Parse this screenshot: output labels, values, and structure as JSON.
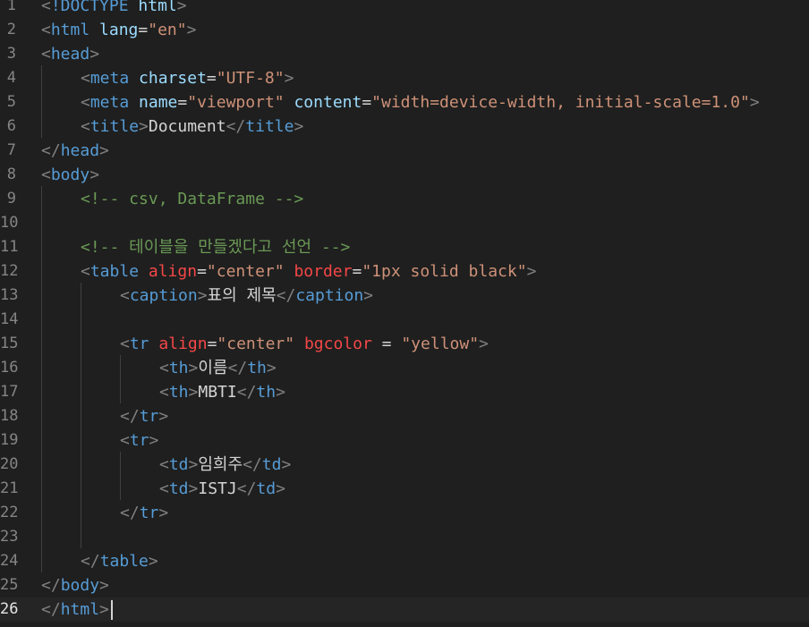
{
  "editor": {
    "language": "html",
    "colors": {
      "background": "#1f1f1f",
      "line_number": "#858585",
      "tag": "#569cd6",
      "attribute": "#9cdcfe",
      "deprecated_attribute": "#f44747",
      "string": "#ce9178",
      "comment": "#6a9955",
      "punctuation": "#808080",
      "text": "#d4d4d4"
    },
    "current_line": 26,
    "lines": [
      {
        "n": "1",
        "indent": 0,
        "tokens": [
          [
            "punct",
            "<"
          ],
          [
            "tag",
            "!DOCTYPE"
          ],
          [
            "text",
            " "
          ],
          [
            "attr",
            "html"
          ],
          [
            "punct",
            ">"
          ]
        ]
      },
      {
        "n": "2",
        "indent": 0,
        "tokens": [
          [
            "punct",
            "<"
          ],
          [
            "tag",
            "html"
          ],
          [
            "text",
            " "
          ],
          [
            "attr",
            "lang"
          ],
          [
            "eq",
            "="
          ],
          [
            "str",
            "\"en\""
          ],
          [
            "punct",
            ">"
          ]
        ]
      },
      {
        "n": "3",
        "indent": 0,
        "tokens": [
          [
            "punct",
            "<"
          ],
          [
            "tag",
            "head"
          ],
          [
            "punct",
            ">"
          ]
        ]
      },
      {
        "n": "4",
        "indent": 1,
        "tokens": [
          [
            "punct",
            "<"
          ],
          [
            "tag",
            "meta"
          ],
          [
            "text",
            " "
          ],
          [
            "attr",
            "charset"
          ],
          [
            "eq",
            "="
          ],
          [
            "str",
            "\"UTF-8\""
          ],
          [
            "punct",
            ">"
          ]
        ]
      },
      {
        "n": "5",
        "indent": 1,
        "tokens": [
          [
            "punct",
            "<"
          ],
          [
            "tag",
            "meta"
          ],
          [
            "text",
            " "
          ],
          [
            "attr",
            "name"
          ],
          [
            "eq",
            "="
          ],
          [
            "str",
            "\"viewport\""
          ],
          [
            "text",
            " "
          ],
          [
            "attr",
            "content"
          ],
          [
            "eq",
            "="
          ],
          [
            "str",
            "\"width=device-width, initial-scale=1.0\""
          ],
          [
            "punct",
            ">"
          ]
        ]
      },
      {
        "n": "6",
        "indent": 1,
        "tokens": [
          [
            "punct",
            "<"
          ],
          [
            "tag",
            "title"
          ],
          [
            "punct",
            ">"
          ],
          [
            "text",
            "Document"
          ],
          [
            "punct",
            "</"
          ],
          [
            "tag",
            "title"
          ],
          [
            "punct",
            ">"
          ]
        ]
      },
      {
        "n": "7",
        "indent": 0,
        "tokens": [
          [
            "punct",
            "</"
          ],
          [
            "tag",
            "head"
          ],
          [
            "punct",
            ">"
          ]
        ]
      },
      {
        "n": "8",
        "indent": 0,
        "tokens": [
          [
            "punct",
            "<"
          ],
          [
            "tag",
            "body"
          ],
          [
            "punct",
            ">"
          ]
        ]
      },
      {
        "n": "9",
        "indent": 1,
        "tokens": [
          [
            "comment",
            "<!-- csv, DataFrame -->"
          ]
        ]
      },
      {
        "n": "10",
        "indent": 0,
        "tokens": []
      },
      {
        "n": "11",
        "indent": 1,
        "tokens": [
          [
            "comment",
            "<!-- 테이블을 만들겠다고 선언 -->"
          ]
        ]
      },
      {
        "n": "12",
        "indent": 1,
        "tokens": [
          [
            "punct",
            "<"
          ],
          [
            "tag",
            "table"
          ],
          [
            "text",
            " "
          ],
          [
            "attr-dep",
            "align"
          ],
          [
            "eq",
            "="
          ],
          [
            "str",
            "\"center\""
          ],
          [
            "text",
            " "
          ],
          [
            "attr-dep",
            "border"
          ],
          [
            "eq",
            "="
          ],
          [
            "str",
            "\"1px solid black\""
          ],
          [
            "punct",
            ">"
          ]
        ]
      },
      {
        "n": "13",
        "indent": 2,
        "tokens": [
          [
            "punct",
            "<"
          ],
          [
            "tag",
            "caption"
          ],
          [
            "punct",
            ">"
          ],
          [
            "text",
            "표의 제목"
          ],
          [
            "punct",
            "</"
          ],
          [
            "tag",
            "caption"
          ],
          [
            "punct",
            ">"
          ]
        ]
      },
      {
        "n": "14",
        "indent": 0,
        "tokens": []
      },
      {
        "n": "15",
        "indent": 2,
        "tokens": [
          [
            "punct",
            "<"
          ],
          [
            "tag",
            "tr"
          ],
          [
            "text",
            " "
          ],
          [
            "attr-dep",
            "align"
          ],
          [
            "eq",
            "="
          ],
          [
            "str",
            "\"center\""
          ],
          [
            "text",
            " "
          ],
          [
            "attr-dep",
            "bgcolor"
          ],
          [
            "text",
            " "
          ],
          [
            "eq",
            "="
          ],
          [
            "text",
            " "
          ],
          [
            "str",
            "\"yellow\""
          ],
          [
            "punct",
            ">"
          ]
        ]
      },
      {
        "n": "16",
        "indent": 3,
        "tokens": [
          [
            "punct",
            "<"
          ],
          [
            "tag",
            "th"
          ],
          [
            "punct",
            ">"
          ],
          [
            "text",
            "이름"
          ],
          [
            "punct",
            "</"
          ],
          [
            "tag",
            "th"
          ],
          [
            "punct",
            ">"
          ]
        ]
      },
      {
        "n": "17",
        "indent": 3,
        "tokens": [
          [
            "punct",
            "<"
          ],
          [
            "tag",
            "th"
          ],
          [
            "punct",
            ">"
          ],
          [
            "text",
            "MBTI"
          ],
          [
            "punct",
            "</"
          ],
          [
            "tag",
            "th"
          ],
          [
            "punct",
            ">"
          ]
        ]
      },
      {
        "n": "18",
        "indent": 2,
        "tokens": [
          [
            "punct",
            "</"
          ],
          [
            "tag",
            "tr"
          ],
          [
            "punct",
            ">"
          ]
        ]
      },
      {
        "n": "19",
        "indent": 2,
        "tokens": [
          [
            "punct",
            "<"
          ],
          [
            "tag",
            "tr"
          ],
          [
            "punct",
            ">"
          ]
        ]
      },
      {
        "n": "20",
        "indent": 3,
        "tokens": [
          [
            "punct",
            "<"
          ],
          [
            "tag",
            "td"
          ],
          [
            "punct",
            ">"
          ],
          [
            "text",
            "임희주"
          ],
          [
            "punct",
            "</"
          ],
          [
            "tag",
            "td"
          ],
          [
            "punct",
            ">"
          ]
        ]
      },
      {
        "n": "21",
        "indent": 3,
        "tokens": [
          [
            "punct",
            "<"
          ],
          [
            "tag",
            "td"
          ],
          [
            "punct",
            ">"
          ],
          [
            "text",
            "ISTJ"
          ],
          [
            "punct",
            "</"
          ],
          [
            "tag",
            "td"
          ],
          [
            "punct",
            ">"
          ]
        ]
      },
      {
        "n": "22",
        "indent": 2,
        "tokens": [
          [
            "punct",
            "</"
          ],
          [
            "tag",
            "tr"
          ],
          [
            "punct",
            ">"
          ]
        ]
      },
      {
        "n": "23",
        "indent": 0,
        "tokens": []
      },
      {
        "n": "24",
        "indent": 1,
        "tokens": [
          [
            "punct",
            "</"
          ],
          [
            "tag",
            "table"
          ],
          [
            "punct",
            ">"
          ]
        ]
      },
      {
        "n": "25",
        "indent": 0,
        "tokens": [
          [
            "punct",
            "</"
          ],
          [
            "tag",
            "body"
          ],
          [
            "punct",
            ">"
          ]
        ]
      },
      {
        "n": "26",
        "indent": 0,
        "tokens": [
          [
            "punct",
            "</"
          ],
          [
            "tag",
            "html"
          ],
          [
            "punct",
            ">"
          ]
        ]
      }
    ]
  }
}
